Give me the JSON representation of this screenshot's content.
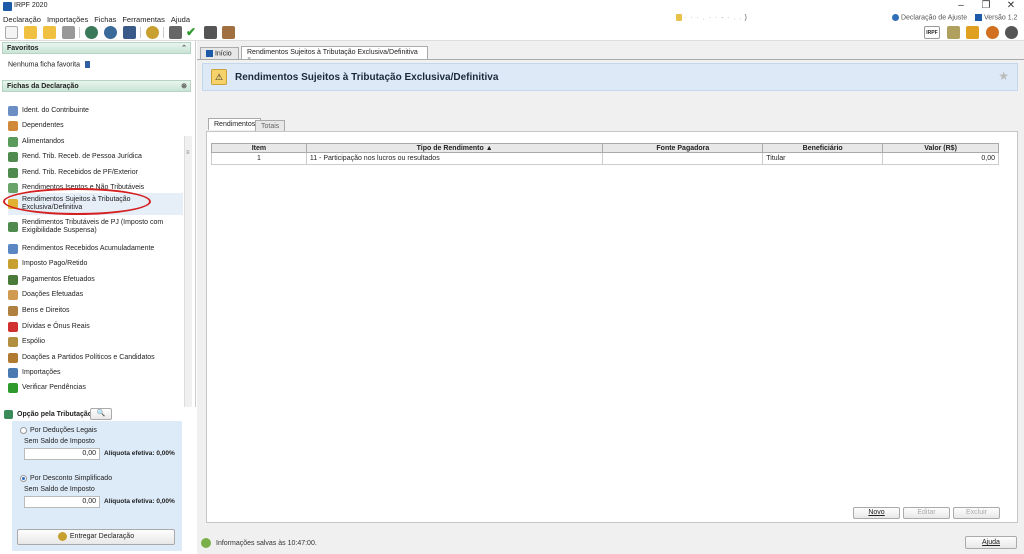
{
  "window": {
    "title": "IRPF 2020"
  },
  "menu": [
    "Declaração",
    "Importações",
    "Fichas",
    "Ferramentas",
    "Ajuda"
  ],
  "top_right": {
    "masked": "·  ·  ·   .   ·   ·   -    ·  .   .",
    "declaracao": "Declaração de Ajuste",
    "versao": "Versão 1.2"
  },
  "sidebar": {
    "favoritos_title": "Favoritos",
    "favoritos_empty": "Nenhuma ficha favorita",
    "fichas_title": "Fichas da Declaração",
    "items": [
      {
        "label": "Ident. do Contribuinte",
        "color": "#6b8fc4"
      },
      {
        "label": "Dependentes",
        "color": "#d08a3a"
      },
      {
        "label": "Alimentandos",
        "color": "#5a9a5a"
      },
      {
        "label": "Rend. Trib. Receb. de Pessoa Jurídica",
        "color": "#4f8a4f"
      },
      {
        "label": "Rend. Trib. Recebidos de PF/Exterior",
        "color": "#4f8a4f"
      },
      {
        "label": "Rendimentos Isentos e Não Tributáveis",
        "color": "#6aa36a"
      },
      {
        "label": "Rendimentos Sujeitos à Tributação\nExclusiva/Definitiva",
        "color": "#e0b030"
      },
      {
        "label": "Rendimentos Tributáveis de PJ (Imposto com\nExigibilidade Suspensa)",
        "color": "#4f8a4f"
      },
      {
        "label": "Rendimentos Recebidos Acumuladamente",
        "color": "#5a86c4"
      },
      {
        "label": "Imposto Pago/Retido",
        "color": "#c8a030"
      },
      {
        "label": "Pagamentos Efetuados",
        "color": "#4a7a3a"
      },
      {
        "label": "Doações Efetuadas",
        "color": "#d09a50"
      },
      {
        "label": "Bens e Direitos",
        "color": "#b08040"
      },
      {
        "label": "Dívidas e Ônus Reais",
        "color": "#d03030"
      },
      {
        "label": "Espólio",
        "color": "#b09040"
      },
      {
        "label": "Doações a Partidos Políticos e Candidatos",
        "color": "#b07a30"
      },
      {
        "label": "Importações",
        "color": "#4a7ab0"
      },
      {
        "label": "Verificar Pendências",
        "color": "#2e9a2e"
      }
    ]
  },
  "tax_option": {
    "title": "Opção pela Tributação:",
    "opt1": "Por Deduções Legais",
    "opt2": "Por Desconto Simplificado",
    "sem_saldo": "Sem Saldo de Imposto",
    "value": "0,00",
    "aliquota": "Alíquota efetiva: 0,00%",
    "entregar": "Entregar Declaração"
  },
  "tabs": {
    "inicio": "Início",
    "active": "Rendimentos Sujeitos à Tributação Exclusiva/Definitiva",
    "close": "×"
  },
  "page_title": "Rendimentos Sujeitos à Tributação Exclusiva/Definitiva",
  "subtabs": [
    "Rendimentos",
    "Totais"
  ],
  "table": {
    "headers": [
      "Item",
      "Tipo de Rendimento ▲",
      "Fonte Pagadora",
      "Beneficiário",
      "Valor (R$)"
    ],
    "rows": [
      [
        "1",
        "11 - Participação nos lucros ou resultados",
        "",
        "Titular",
        "0,00"
      ]
    ]
  },
  "buttons": {
    "novo": "Novo",
    "editar": "Editar",
    "excluir": "Excluir",
    "ajuda": "Ajuda"
  },
  "status": "Informações salvas às 10:47:00."
}
